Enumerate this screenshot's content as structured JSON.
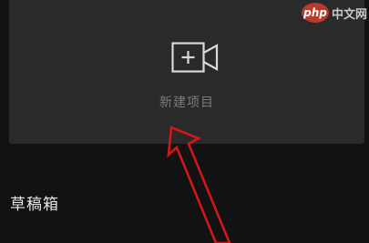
{
  "new_project": {
    "label": "新建项目",
    "icon": "video-camera-plus-icon"
  },
  "drafts": {
    "title": "草稿箱"
  },
  "watermark": {
    "logo_text": "php",
    "site_text": "中文网"
  },
  "colors": {
    "background": "#121212",
    "card": "#2a2a2a",
    "icon_stroke": "#d9d9d9",
    "label": "#7a7a7a",
    "heading": "#e6e6e6",
    "annotation_arrow": "#d01818"
  }
}
